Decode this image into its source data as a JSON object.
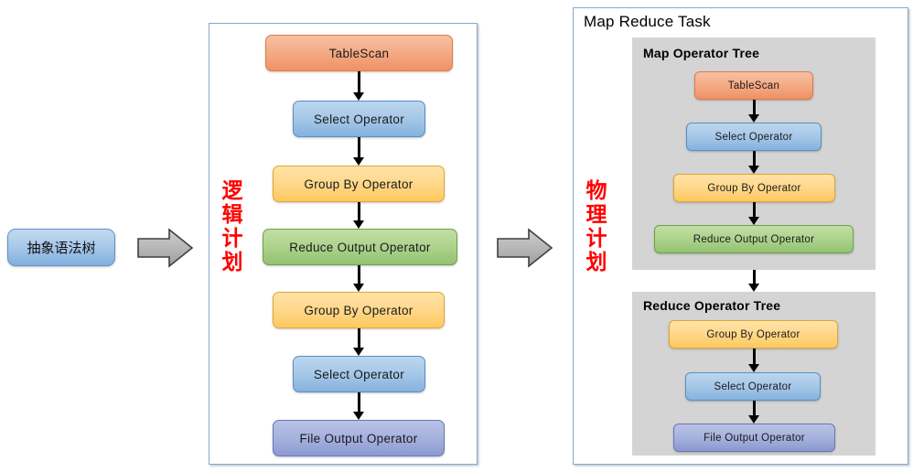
{
  "diagram": {
    "title_hidden": "Hive query plan stages"
  },
  "ast": {
    "label": "抽象语法树"
  },
  "arrows": {
    "arrow1_name": "block-arrow-right",
    "arrow2_name": "block-arrow-right"
  },
  "logical_plan": {
    "side_label_chars": [
      "逻",
      "辑",
      "计",
      "划"
    ],
    "nodes": [
      {
        "label": "TableScan",
        "color": "#ef9166"
      },
      {
        "label": "Select Operator",
        "color": "#84b2dd"
      },
      {
        "label": "Group By Operator",
        "color": "#fdc85f"
      },
      {
        "label": "Reduce Output Operator",
        "color": "#93c272"
      },
      {
        "label": "Group By Operator",
        "color": "#fdc85f"
      },
      {
        "label": "Select Operator",
        "color": "#84b2dd"
      },
      {
        "label": "File Output Operator",
        "color": "#8b99d0"
      }
    ]
  },
  "physical_plan": {
    "side_label_chars": [
      "物",
      "理",
      "计",
      "划"
    ],
    "panel_title": "Map Reduce Task",
    "map_tree": {
      "title": "Map Operator Tree",
      "nodes": [
        {
          "label": "TableScan",
          "color": "#ef9166"
        },
        {
          "label": "Select Operator",
          "color": "#84b2dd"
        },
        {
          "label": "Group By Operator",
          "color": "#fdc85f"
        },
        {
          "label": "Reduce Output Operator",
          "color": "#93c272"
        }
      ]
    },
    "reduce_tree": {
      "title": "Reduce Operator Tree",
      "nodes": [
        {
          "label": "Group By Operator",
          "color": "#fdc85f"
        },
        {
          "label": "Select Operator",
          "color": "#84b2dd"
        },
        {
          "label": "File Output Operator",
          "color": "#8b99d0"
        }
      ]
    }
  },
  "colors": {
    "panel_border": "#8ba7cc",
    "gray_group": "#d4d4d4",
    "red_label": "#ff0000",
    "arrow_gray": "#b3b3b3",
    "arrow_outline": "#404040"
  }
}
